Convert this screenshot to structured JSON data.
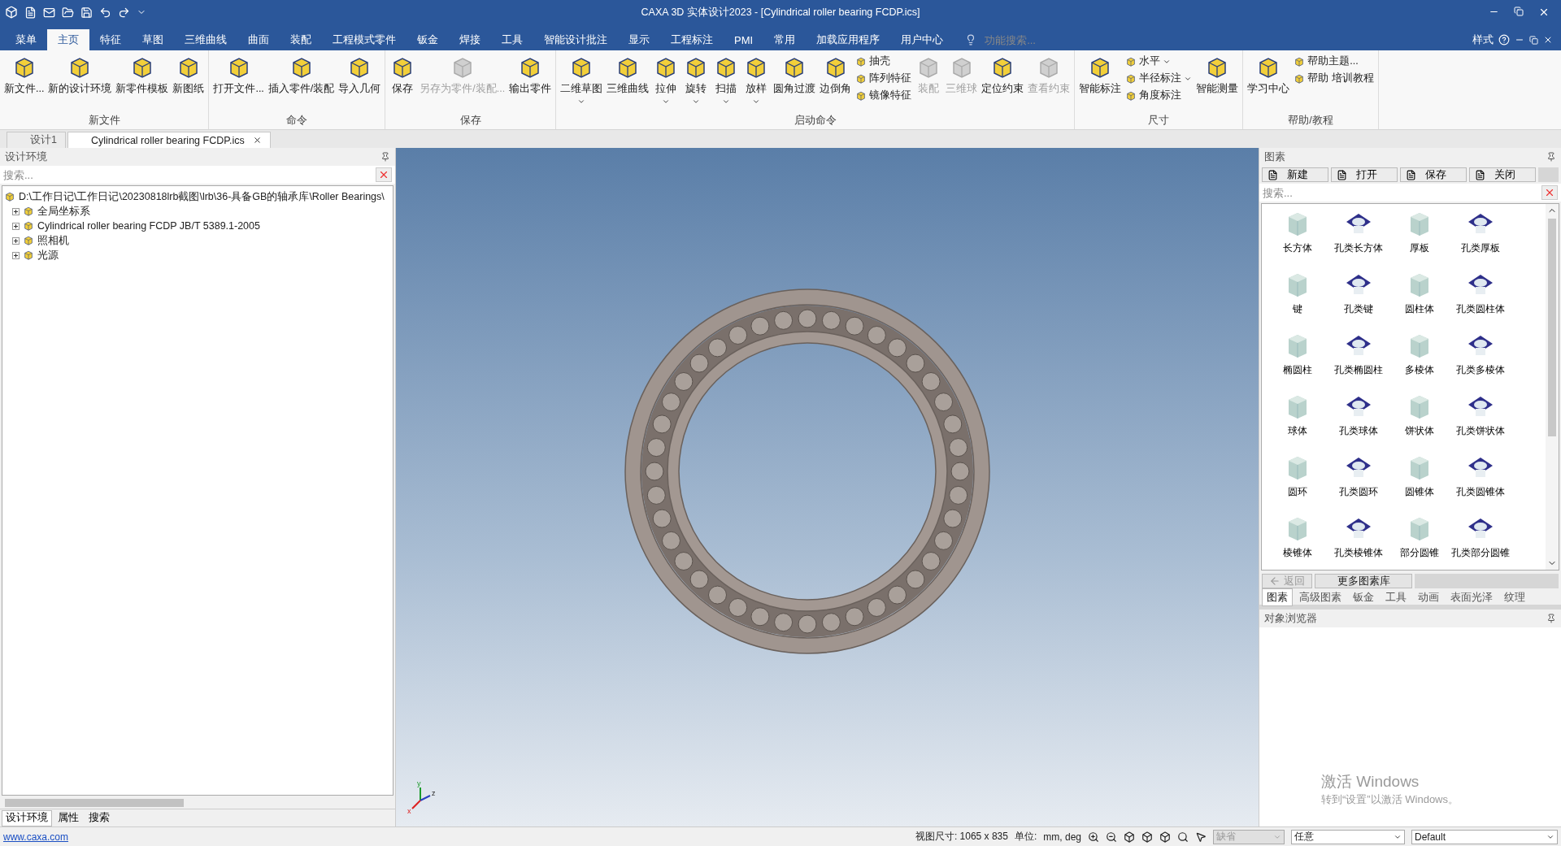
{
  "title_bar": {
    "title": "CAXA 3D 实体设计2023 - [Cylindrical roller bearing FCDP.ics]"
  },
  "menu_tabs": [
    {
      "label": "菜单",
      "selected": false
    },
    {
      "label": "主页",
      "selected": true
    },
    {
      "label": "特征",
      "selected": false
    },
    {
      "label": "草图",
      "selected": false
    },
    {
      "label": "三维曲线",
      "selected": false
    },
    {
      "label": "曲面",
      "selected": false
    },
    {
      "label": "装配",
      "selected": false
    },
    {
      "label": "工程模式零件",
      "selected": false
    },
    {
      "label": "钣金",
      "selected": false
    },
    {
      "label": "焊接",
      "selected": false
    },
    {
      "label": "工具",
      "selected": false
    },
    {
      "label": "智能设计批注",
      "selected": false
    },
    {
      "label": "显示",
      "selected": false
    },
    {
      "label": "工程标注",
      "selected": false
    },
    {
      "label": "PMI",
      "selected": false
    },
    {
      "label": "常用",
      "selected": false
    },
    {
      "label": "加载应用程序",
      "selected": false
    },
    {
      "label": "用户中心",
      "selected": false
    }
  ],
  "feature_search": {
    "placeholder": "功能搜索..."
  },
  "style_menu": {
    "label": "样式"
  },
  "ribbon": [
    {
      "title": "新文件",
      "items": [
        {
          "kind": "large",
          "label": "新文件...",
          "disabled": false,
          "dropdown": false
        },
        {
          "kind": "large",
          "label": "新的设计环境",
          "disabled": false,
          "dropdown": false
        },
        {
          "kind": "large",
          "label": "新零件模板",
          "disabled": false,
          "dropdown": false
        },
        {
          "kind": "large",
          "label": "新图纸",
          "disabled": false,
          "dropdown": false
        }
      ]
    },
    {
      "title": "命令",
      "items": [
        {
          "kind": "large",
          "label": "打开文件...",
          "disabled": false,
          "dropdown": false
        },
        {
          "kind": "large",
          "label": "插入零件/装配",
          "disabled": false,
          "dropdown": false
        },
        {
          "kind": "large",
          "label": "导入几何",
          "disabled": false,
          "dropdown": false
        }
      ]
    },
    {
      "title": "保存",
      "items": [
        {
          "kind": "large",
          "label": "保存",
          "disabled": false,
          "dropdown": false
        },
        {
          "kind": "large",
          "label": "另存为零件/装配...",
          "disabled": true,
          "dropdown": false
        },
        {
          "kind": "large",
          "label": "输出零件",
          "disabled": false,
          "dropdown": false
        }
      ]
    },
    {
      "title": "启动命令",
      "items": [
        {
          "kind": "large",
          "label": "二维草图",
          "disabled": false,
          "dropdown": true
        },
        {
          "kind": "large",
          "label": "三维曲线",
          "disabled": false,
          "dropdown": false
        },
        {
          "kind": "large",
          "label": "拉伸",
          "disabled": false,
          "dropdown": true
        },
        {
          "kind": "large",
          "label": "旋转",
          "disabled": false,
          "dropdown": true
        },
        {
          "kind": "large",
          "label": "扫描",
          "disabled": false,
          "dropdown": true
        },
        {
          "kind": "large",
          "label": "放样",
          "disabled": false,
          "dropdown": true
        },
        {
          "kind": "large",
          "label": "圆角过渡",
          "disabled": false,
          "dropdown": false
        },
        {
          "kind": "large",
          "label": "边倒角",
          "disabled": false,
          "dropdown": false
        },
        {
          "kind": "stack",
          "items": [
            {
              "label": "抽壳",
              "dropdown": false
            },
            {
              "label": "阵列特征",
              "dropdown": false
            },
            {
              "label": "镜像特征",
              "dropdown": false
            }
          ]
        },
        {
          "kind": "large",
          "label": "装配",
          "disabled": true,
          "dropdown": false
        },
        {
          "kind": "large",
          "label": "三维球",
          "disabled": true,
          "dropdown": false
        },
        {
          "kind": "large",
          "label": "定位约束",
          "disabled": false,
          "dropdown": false
        },
        {
          "kind": "large",
          "label": "查看约束",
          "disabled": true,
          "dropdown": false
        }
      ]
    },
    {
      "title": "尺寸",
      "items": [
        {
          "kind": "large",
          "label": "智能标注",
          "disabled": false,
          "dropdown": false
        },
        {
          "kind": "stack",
          "items": [
            {
              "label": "水平",
              "dropdown": true
            },
            {
              "label": "半径标注",
              "dropdown": true
            },
            {
              "label": "角度标注",
              "dropdown": false
            }
          ]
        },
        {
          "kind": "large",
          "label": "智能测量",
          "disabled": false,
          "dropdown": false
        }
      ]
    },
    {
      "title": "帮助/教程",
      "items": [
        {
          "kind": "large",
          "label": "学习中心",
          "disabled": false,
          "dropdown": false
        },
        {
          "kind": "stack",
          "items": [
            {
              "label": "帮助主题...",
              "dropdown": false
            },
            {
              "label": "帮助 培训教程",
              "dropdown": false
            }
          ]
        }
      ]
    }
  ],
  "doc_tabs": [
    {
      "label": "设计1",
      "selected": false,
      "closable": false
    },
    {
      "label": "Cylindrical roller bearing FCDP.ics",
      "selected": true,
      "closable": true
    }
  ],
  "design_panel": {
    "title": "设计环境",
    "search": {
      "placeholder": "搜索..."
    },
    "tree": [
      {
        "label": "D:\\工作日记\\工作日记\\20230818lrb截图\\lrb\\36-具备GB的轴承库\\Roller Bearings\\",
        "children": [
          {
            "label": "全局坐标系",
            "expanded": false
          },
          {
            "label": "Cylindrical roller bearing FCDP JB/T 5389.1-2005",
            "expanded": false
          },
          {
            "label": "照相机",
            "expanded": false
          },
          {
            "label": "光源",
            "expanded": false
          }
        ]
      }
    ],
    "bottom_tabs": [
      {
        "label": "设计环境",
        "selected": true
      },
      {
        "label": "属性",
        "selected": false
      },
      {
        "label": "搜索",
        "selected": false
      }
    ]
  },
  "viewport": {
    "axis_labels": [
      "y",
      "z",
      "x"
    ]
  },
  "catalog_panel": {
    "title": "图素",
    "buttons": [
      "新建",
      "打开",
      "保存",
      "关闭"
    ],
    "search": {
      "placeholder": "搜索..."
    },
    "items": [
      {
        "label": "长方体",
        "kind": "solid"
      },
      {
        "label": "孔类长方体",
        "kind": "hole"
      },
      {
        "label": "厚板",
        "kind": "solid"
      },
      {
        "label": "孔类厚板",
        "kind": "hole"
      },
      {
        "label": "键",
        "kind": "solid"
      },
      {
        "label": "孔类键",
        "kind": "hole"
      },
      {
        "label": "圆柱体",
        "kind": "solid"
      },
      {
        "label": "孔类圆柱体",
        "kind": "hole"
      },
      {
        "label": "椭圆柱",
        "kind": "solid"
      },
      {
        "label": "孔类椭圆柱",
        "kind": "hole"
      },
      {
        "label": "多棱体",
        "kind": "solid"
      },
      {
        "label": "孔类多棱体",
        "kind": "hole"
      },
      {
        "label": "球体",
        "kind": "solid"
      },
      {
        "label": "孔类球体",
        "kind": "hole"
      },
      {
        "label": "饼状体",
        "kind": "solid"
      },
      {
        "label": "孔类饼状体",
        "kind": "hole"
      },
      {
        "label": "圆环",
        "kind": "solid"
      },
      {
        "label": "孔类圆环",
        "kind": "hole"
      },
      {
        "label": "圆锥体",
        "kind": "solid"
      },
      {
        "label": "孔类圆锥体",
        "kind": "hole"
      },
      {
        "label": "棱锥体",
        "kind": "solid"
      },
      {
        "label": "孔类棱锥体",
        "kind": "hole"
      },
      {
        "label": "部分圆锥",
        "kind": "solid"
      },
      {
        "label": "孔类部分圆锥",
        "kind": "hole"
      }
    ],
    "back": {
      "label": "返回",
      "disabled": true
    },
    "more": {
      "label": "更多图素库"
    },
    "tabs": [
      {
        "label": "图素",
        "selected": true
      },
      {
        "label": "高级图素",
        "selected": false
      },
      {
        "label": "钣金",
        "selected": false
      },
      {
        "label": "工具",
        "selected": false
      },
      {
        "label": "动画",
        "selected": false
      },
      {
        "label": "表面光泽",
        "selected": false
      },
      {
        "label": "纹理",
        "selected": false
      }
    ]
  },
  "object_browser": {
    "title": "对象浏览器"
  },
  "windows_notice": {
    "heading": "激活 Windows",
    "text": "转到“设置”以激活 Windows。"
  },
  "status_bar": {
    "link": "www.caxa.com",
    "view_size": "视图尺寸: 1065 x  835",
    "unit_label": "单位:",
    "unit_value": "mm, deg",
    "combos": [
      {
        "value": "缺省",
        "disabled": true
      },
      {
        "value": "任意",
        "disabled": false
      },
      {
        "value": "Default",
        "disabled": false
      }
    ]
  }
}
